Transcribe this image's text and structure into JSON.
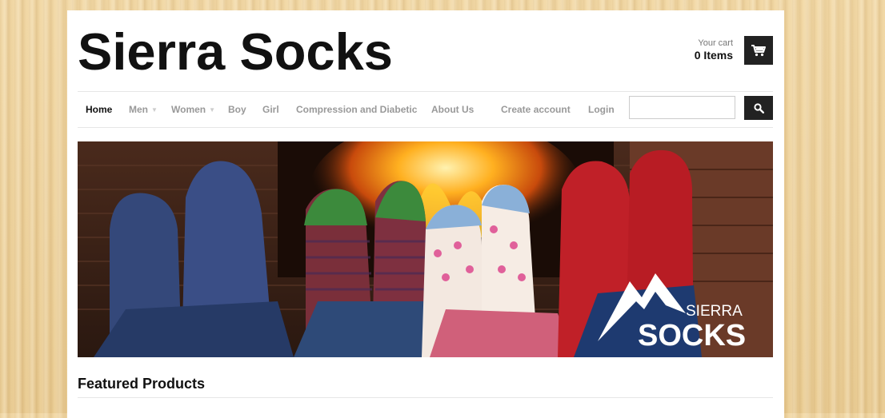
{
  "store": {
    "name": "Sierra Socks"
  },
  "cart": {
    "label": "Your cart",
    "count_text": "0 Items",
    "icon": "shopping-cart-icon"
  },
  "nav": {
    "items": [
      {
        "label": "Home",
        "active": true
      },
      {
        "label": "Men",
        "dropdown": true
      },
      {
        "label": "Women",
        "dropdown": true
      },
      {
        "label": "Boy"
      },
      {
        "label": "Girl"
      },
      {
        "label": "Compression and Diabetic"
      },
      {
        "label": "About Us"
      },
      {
        "label": "Create account"
      },
      {
        "label": "Login"
      }
    ]
  },
  "search": {
    "value": "",
    "placeholder": "",
    "icon": "search-icon"
  },
  "hero": {
    "logo_line1": "SIERRA",
    "logo_line2": "SOCKS"
  },
  "featured": {
    "title": "Featured Products"
  },
  "colors": {
    "wood": "#ecd09a",
    "dark_button": "#222222",
    "nav_active": "#111111",
    "nav_inactive": "#999999"
  }
}
